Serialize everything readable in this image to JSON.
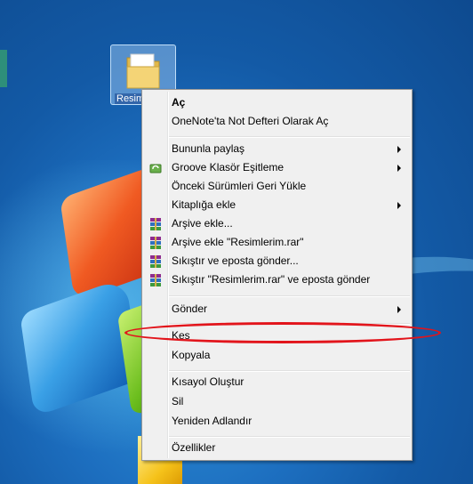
{
  "desktop": {
    "icon_label": "Resimler",
    "icon_semantic": "folder-icon"
  },
  "menu": {
    "items": [
      {
        "label": "Aç",
        "bold": true
      },
      {
        "label": "OneNote'ta Not Defteri Olarak Aç"
      },
      {
        "label": "Bununla paylaş",
        "submenu": true
      },
      {
        "label": "Groove Klasör Eşitleme",
        "submenu": true,
        "icon": "groove-sync-icon"
      },
      {
        "label": "Önceki Sürümleri Geri Yükle"
      },
      {
        "label": "Kitaplığa ekle",
        "submenu": true
      },
      {
        "label": "Arşive ekle...",
        "icon": "winrar-icon"
      },
      {
        "label": "Arşive ekle \"Resimlerim.rar\"",
        "icon": "winrar-icon"
      },
      {
        "label": "Sıkıştır ve eposta gönder...",
        "icon": "winrar-icon"
      },
      {
        "label": "Sıkıştır \"Resimlerim.rar\" ve eposta gönder",
        "icon": "winrar-icon"
      },
      {
        "label": "Gönder",
        "submenu": true
      },
      {
        "label": "Kes",
        "highlighted_by_annotation": true
      },
      {
        "label": "Kopyala"
      },
      {
        "label": "Kısayol Oluştur"
      },
      {
        "label": "Sil"
      },
      {
        "label": "Yeniden Adlandır"
      },
      {
        "label": "Özellikler"
      }
    ]
  },
  "colors": {
    "annotation": "#e2141b",
    "menu_bg": "#f0f0f0",
    "desktop_blue": "#1d6fc0"
  }
}
